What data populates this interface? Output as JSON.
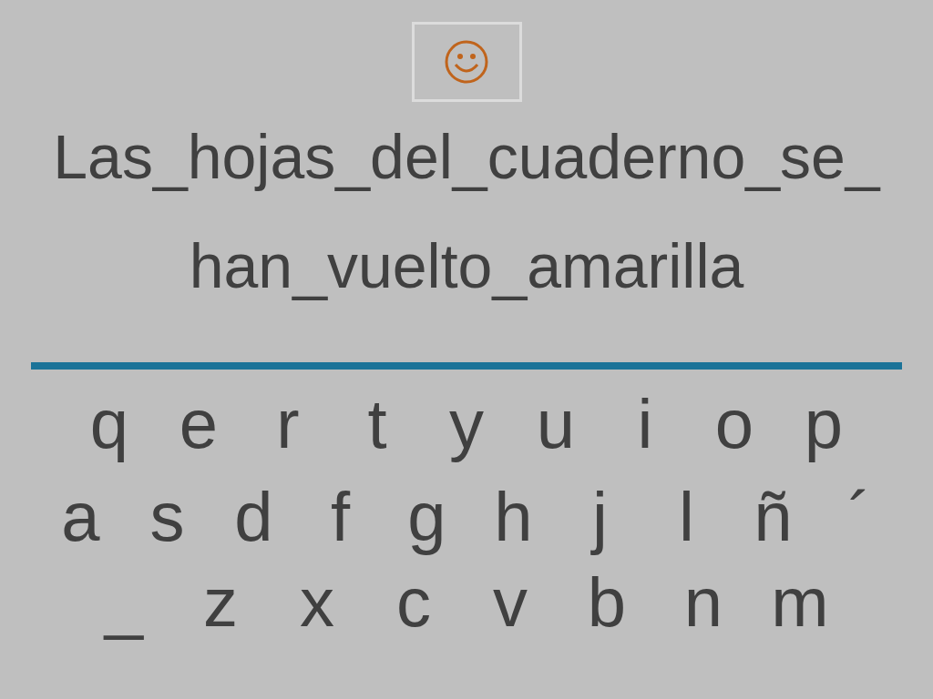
{
  "sentence_lines": [
    "Las_hojas_del_cuaderno_se_",
    "han_vuelto_amarilla"
  ],
  "keyboard": {
    "rows": [
      {
        "keys": [
          "q",
          "e",
          "r",
          "t",
          "y",
          "u",
          "i",
          "o",
          "p"
        ]
      },
      {
        "keys": [
          "a",
          "s",
          "d",
          "f",
          "g",
          "h",
          "j",
          "l",
          "ñ",
          "´"
        ]
      },
      {
        "keys": [
          "_",
          "z",
          "x",
          "c",
          "v",
          "b",
          "n",
          "m"
        ]
      }
    ]
  }
}
